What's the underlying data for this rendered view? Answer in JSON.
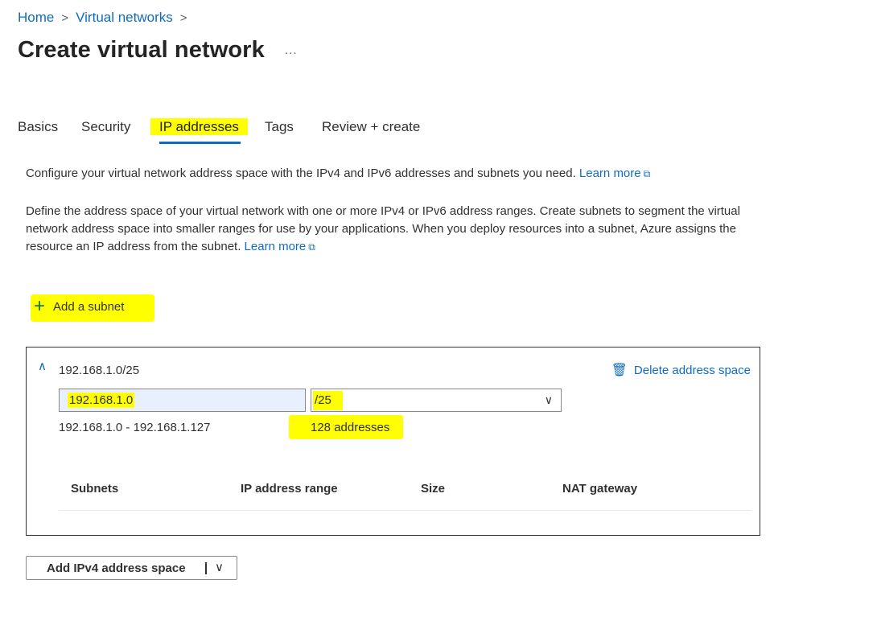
{
  "breadcrumb": {
    "items": [
      "Home",
      "Virtual networks"
    ],
    "separator": ">"
  },
  "page": {
    "title": "Create virtual network",
    "more": "..."
  },
  "tabs": [
    {
      "label": "Basics"
    },
    {
      "label": "Security"
    },
    {
      "label": "IP addresses",
      "active": true
    },
    {
      "label": "Tags"
    },
    {
      "label": "Review + create"
    }
  ],
  "description": {
    "line1": "Configure your virtual network address space with the IPv4 and IPv6 addresses and subnets you need.",
    "line2": "Define the address space of your virtual network with one or more IPv4 or IPv6 address ranges. Create subnets to segment the virtual network address space into smaller ranges for use by your applications. When you deploy resources into a subnet, Azure assigns the resource an IP address from the subnet.",
    "learn_more": "Learn more"
  },
  "add_subnet": {
    "label": "Add a subnet"
  },
  "address_space": {
    "cidr": "192.168.1.0/25",
    "delete_label": "Delete address space",
    "ip_value": "192.168.1.0",
    "prefix_value": "/25",
    "range": "192.168.1.0 - 192.168.1.127",
    "address_count": "128 addresses"
  },
  "subnets_table": {
    "columns": [
      "Subnets",
      "IP address range",
      "Size",
      "NAT gateway"
    ]
  },
  "add_space_button": {
    "label": "Add IPv4 address space"
  },
  "colors": {
    "link": "#0f6cbd",
    "highlight": "#ffff00",
    "plus": "#107c10",
    "text": "#323130"
  },
  "icons": {
    "external_link": "external-link-icon",
    "plus": "plus-icon",
    "trash": "trash-icon",
    "chevron_up": "chevron-up-icon",
    "chevron_down": "chevron-down-icon"
  }
}
